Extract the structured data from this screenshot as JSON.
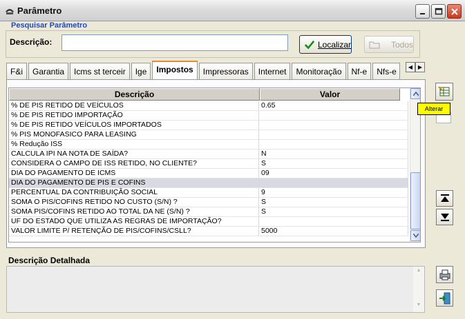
{
  "window": {
    "title": "Parâmetro"
  },
  "search": {
    "section_label": "Pesquisar Parâmetro",
    "description_label": "Descrição:",
    "description_value": "",
    "locate_button": "Localizar",
    "all_button": "Todos"
  },
  "tabs": [
    "F&i",
    "Garantia",
    "Icms st terceir",
    "Ige",
    "Impostos",
    "Impressoras",
    "Internet",
    "Monitoração",
    "Nf-e",
    "Nfs-e"
  ],
  "active_tab": "Impostos",
  "grid": {
    "columns": [
      "Descrição",
      "Valor"
    ],
    "rows": [
      {
        "descricao": "% DE PIS RETIDO DE VEÍCULOS",
        "valor": "0.65"
      },
      {
        "descricao": "% DE PIS RETIDO IMPORTAÇÃO",
        "valor": ""
      },
      {
        "descricao": "% DE PIS RETIDO VEÍCULOS IMPORTADOS",
        "valor": ""
      },
      {
        "descricao": "% PIS MONOFASICO PARA LEASING",
        "valor": ""
      },
      {
        "descricao": "% Redução ISS",
        "valor": ""
      },
      {
        "descricao": "CALCULA IPI NA NOTA DE SAÍDA?",
        "valor": "N"
      },
      {
        "descricao": "CONSIDERA O CAMPO DE ISS RETIDO, NO CLIENTE?",
        "valor": "S"
      },
      {
        "descricao": "DIA DO PAGAMENTO DE ICMS",
        "valor": "09"
      },
      {
        "descricao": "DIA DO PAGAMENTO DE PIS E COFINS",
        "valor": ""
      },
      {
        "descricao": "PERCENTUAL DA CONTRIBUIÇÃO SOCIAL",
        "valor": "9"
      },
      {
        "descricao": "SOMA O PIS/COFINS RETIDO NO CUSTO (S/N) ?",
        "valor": "S"
      },
      {
        "descricao": "SOMA PIS/COFINS RETIDO AO TOTAL DA NE (S/N) ?",
        "valor": "S"
      },
      {
        "descricao": "UF DO ESTADO QUE UTILIZA AS REGRAS DE IMPORTAÇÃO?",
        "valor": ""
      },
      {
        "descricao": "VALOR LIMITE P/ RETENÇÃO DE PIS/COFINS/CSLL?",
        "valor": "5000"
      }
    ],
    "selected_row": 8
  },
  "side": {
    "alter_tooltip": "Alterar"
  },
  "detail": {
    "label": "Descrição Detalhada",
    "text": ""
  },
  "icons": [
    "window-app-icon",
    "minimize-icon",
    "maximize-icon",
    "close-icon",
    "checkmark-icon",
    "folder-icon",
    "edit-table-icon",
    "move-up-icon",
    "move-down-icon",
    "print-icon",
    "exit-icon"
  ]
}
